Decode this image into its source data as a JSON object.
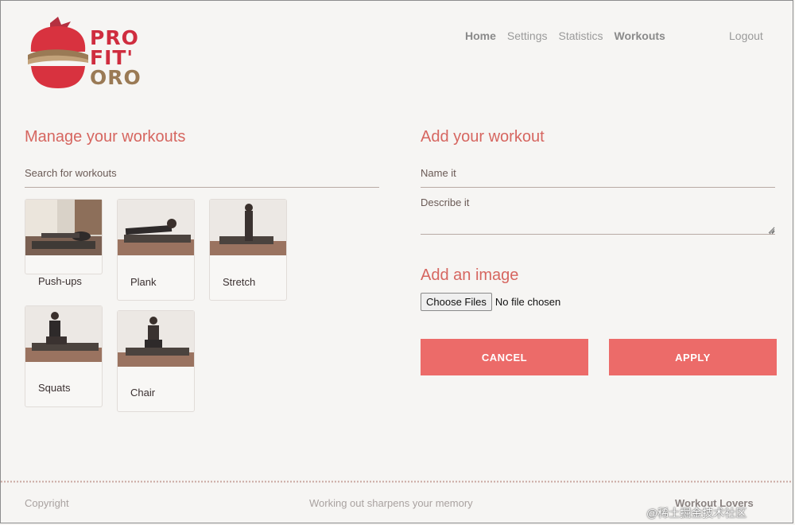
{
  "header": {
    "logo_lines": [
      "PRO",
      "FIT'",
      "ORO"
    ],
    "nav": [
      {
        "label": "Home",
        "bold": true
      },
      {
        "label": "Settings",
        "bold": false
      },
      {
        "label": "Statistics",
        "bold": false
      },
      {
        "label": "Workouts",
        "bold": true
      }
    ],
    "logout": "Logout"
  },
  "left": {
    "title": "Manage your workouts",
    "search_placeholder": "Search for workouts",
    "workouts": [
      {
        "name": "Push-ups"
      },
      {
        "name": "Plank"
      },
      {
        "name": "Stretch"
      },
      {
        "name": "Squats"
      },
      {
        "name": "Chair"
      }
    ]
  },
  "right": {
    "title": "Add your workout",
    "name_placeholder": "Name it",
    "describe_placeholder": "Describe it",
    "image_title": "Add an image",
    "file_button": "Choose Files",
    "file_status": "No file chosen",
    "cancel": "CANCEL",
    "apply": "APPLY"
  },
  "footer": {
    "copyright": "Copyright",
    "tagline": "Working out sharpens your memory",
    "brand": "Workout Lovers",
    "watermark": "@稀土掘金技术社区"
  },
  "colors": {
    "accent": "#ec6b69",
    "title": "#d66660",
    "tomato": "#cf2d3f"
  }
}
